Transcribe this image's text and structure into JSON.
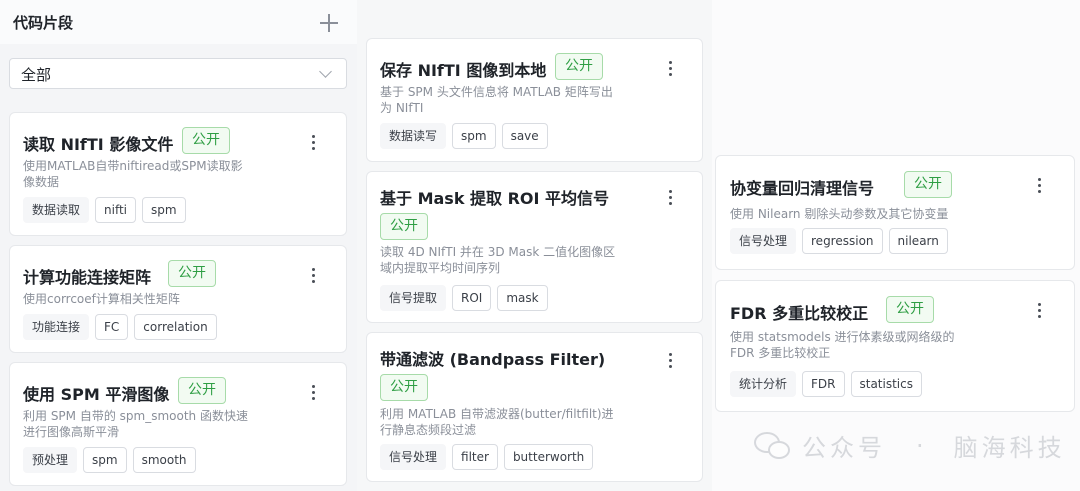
{
  "panel": {
    "title": "代码片段",
    "filter_value": "全部"
  },
  "badge_label": "公开",
  "cards": [
    {
      "title": "读取 NIfTI 影像文件",
      "desc": [
        "使用MATLAB自带niftiread或SPM读取影",
        "像数据"
      ],
      "tags": [
        "数据读取",
        "nifti",
        "spm"
      ]
    },
    {
      "title": "计算功能连接矩阵",
      "desc": [
        "使用corrcoef计算相关性矩阵"
      ],
      "tags": [
        "功能连接",
        "FC",
        "correlation"
      ]
    },
    {
      "title": "使用 SPM 平滑图像",
      "desc": [
        "利用 SPM 自带的 spm_smooth 函数快速",
        "进行图像高斯平滑"
      ],
      "tags": [
        "预处理",
        "spm",
        "smooth"
      ]
    },
    {
      "title": "保存 NIfTI 图像到本地",
      "desc": [
        "基于 SPM 头文件信息将 MATLAB 矩阵写出",
        "为 NIfTI"
      ],
      "tags": [
        "数据读写",
        "spm",
        "save"
      ]
    },
    {
      "title": "基于 Mask 提取 ROI 平均信号",
      "desc": [
        "读取 4D NIfTI 并在 3D Mask 二值化图像区",
        "域内提取平均时间序列"
      ],
      "tags": [
        "信号提取",
        "ROI",
        "mask"
      ]
    },
    {
      "title": "带通滤波 (Bandpass Filter)",
      "desc": [
        "利用 MATLAB 自带滤波器(butter/filtfilt)进",
        "行静息态频段过滤"
      ],
      "tags": [
        "信号处理",
        "filter",
        "butterworth"
      ]
    },
    {
      "title": "协变量回归清理信号",
      "desc": [
        "使用 Nilearn 剔除头动参数及其它协变量"
      ],
      "tags": [
        "信号处理",
        "regression",
        "nilearn"
      ]
    },
    {
      "title": "FDR 多重比较校正",
      "desc": [
        "使用 statsmodels 进行体素级或网络级的",
        "FDR 多重比较校正"
      ],
      "tags": [
        "统计分析",
        "FDR",
        "statistics"
      ]
    }
  ],
  "watermark": {
    "left": "公众号",
    "right": "脑海科技"
  }
}
